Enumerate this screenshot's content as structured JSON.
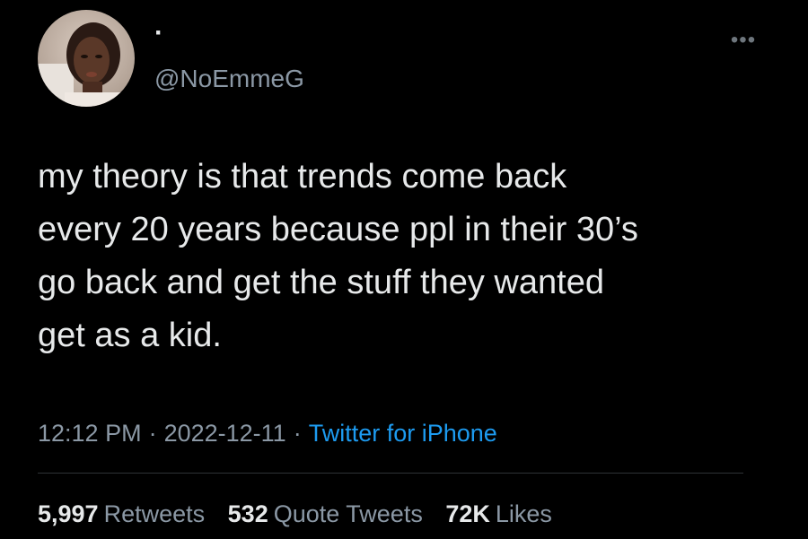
{
  "author": {
    "display_name": "·",
    "handle": "@NoEmmeG",
    "avatar_icon": "profile-photo-avatar"
  },
  "more_icon": "more-options-icon",
  "tweet": {
    "text": "my theory is that trends come back\nevery 20 years because ppl in their 30’s\ngo back and get the stuff they wanted\nget as a kid."
  },
  "meta": {
    "time": "12:12 PM",
    "separator": "·",
    "date": "2022-12-11",
    "source": "Twitter for iPhone"
  },
  "stats": {
    "retweets": {
      "count": "5,997",
      "label": "Retweets"
    },
    "quote_tweets": {
      "count": "532",
      "label": "Quote Tweets"
    },
    "likes": {
      "count": "72K",
      "label": "Likes"
    }
  },
  "colors": {
    "background": "#000000",
    "text_primary": "#e7e9ea",
    "text_secondary": "#8b98a5",
    "link": "#1d9bf0",
    "divider": "#2f3336"
  }
}
